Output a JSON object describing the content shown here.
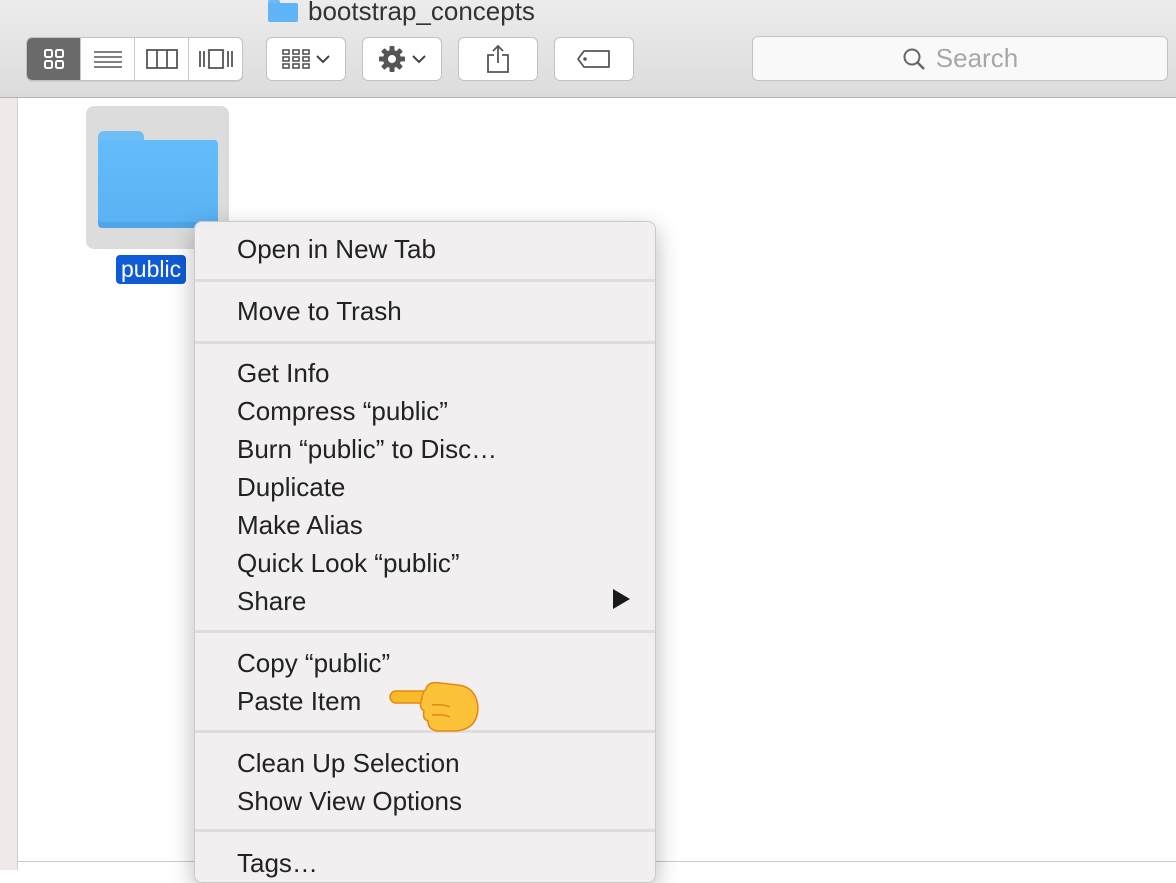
{
  "window": {
    "title": "bootstrap_concepts"
  },
  "toolbar": {
    "view_modes": [
      "icon-view",
      "list-view",
      "column-view",
      "cover-flow-view"
    ],
    "active_view": "icon-view",
    "arrange_icon": "grid-icon",
    "action_icon": "gear-icon",
    "share_icon": "share-icon",
    "tag_icon": "tag-icon"
  },
  "search": {
    "placeholder": "Search"
  },
  "items": [
    {
      "name": "public",
      "kind": "folder",
      "selected": true
    }
  ],
  "context_menu": {
    "groups": [
      [
        "Open in New Tab"
      ],
      [
        "Move to Trash"
      ],
      [
        "Get Info",
        "Compress “public”",
        "Burn “public” to Disc…",
        "Duplicate",
        "Make Alias",
        "Quick Look “public”",
        "Share"
      ],
      [
        "Copy “public”",
        "Paste Item"
      ],
      [
        "Clean Up Selection",
        "Show View Options"
      ],
      [
        "Tags…"
      ]
    ],
    "submenu_item": "Share",
    "pointed_item": "Paste Item"
  },
  "colors": {
    "selection": "#0f5bd5",
    "folder": "#5fb5f7",
    "menu_bg": "#f1efef"
  }
}
